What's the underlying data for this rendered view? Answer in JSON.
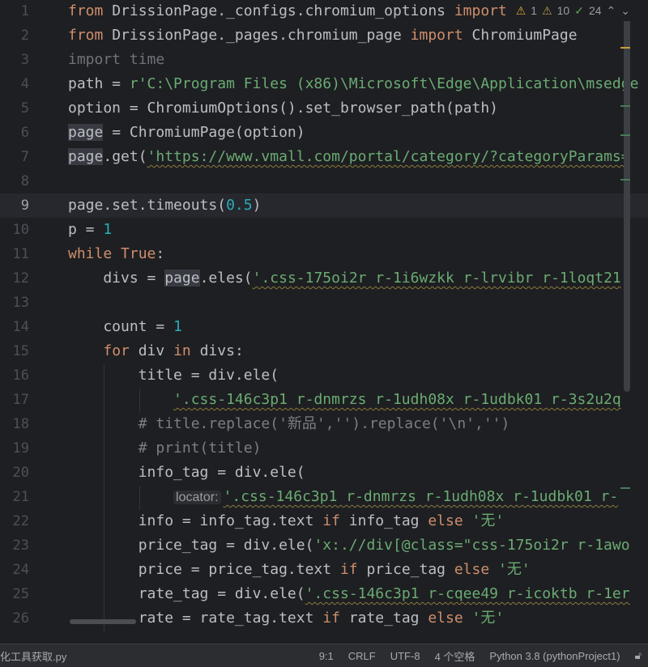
{
  "inspections": {
    "errors": "1",
    "warnings": "10",
    "ok": "24"
  },
  "lines": [
    [
      [
        "from ",
        "kw"
      ],
      [
        "DrissionPage._configs.chromium_options ",
        ""
      ],
      [
        "import",
        "kw"
      ]
    ],
    [
      [
        "from ",
        "kw"
      ],
      [
        "DrissionPage._pages.chromium_page ",
        ""
      ],
      [
        "import ",
        "kw"
      ],
      [
        "ChromiumPage",
        ""
      ]
    ],
    [
      [
        "import time",
        "dim"
      ]
    ],
    [
      [
        "path = ",
        ""
      ],
      [
        "r'C:\\Program Files (x86)\\Microsoft\\Edge\\Application\\msedge",
        "st"
      ]
    ],
    [
      [
        "option = ChromiumOptions().set_browser_path(path)",
        ""
      ]
    ],
    [
      [
        "page",
        "hl"
      ],
      [
        " = ChromiumPage(option)",
        ""
      ]
    ],
    [
      [
        "page",
        "hl"
      ],
      [
        ".get(",
        ""
      ],
      [
        "'https://www.vmall.com/portal/category/?categoryParams=",
        "st wavy"
      ]
    ],
    [],
    [
      [
        "page.set.timeouts(",
        ""
      ],
      [
        "0.5",
        "nu"
      ],
      [
        ")",
        ""
      ]
    ],
    [
      [
        "p = ",
        ""
      ],
      [
        "1",
        "nu"
      ]
    ],
    [
      [
        "while ",
        "kw"
      ],
      [
        "True",
        "kw"
      ],
      [
        ":",
        ""
      ]
    ],
    [
      [
        "    divs = ",
        ""
      ],
      [
        "page",
        "hl"
      ],
      [
        ".eles(",
        ""
      ],
      [
        "'.css-175oi2r r-1i6wzkk r-lrvibr r-1loqt21",
        "st wavy"
      ]
    ],
    [],
    [
      [
        "    count = ",
        ""
      ],
      [
        "1",
        "nu"
      ]
    ],
    [
      [
        "    ",
        ""
      ],
      [
        "for ",
        "kw"
      ],
      [
        "div ",
        ""
      ],
      [
        "in ",
        "kw"
      ],
      [
        "divs:",
        ""
      ]
    ],
    [
      [
        "        title = div.ele(",
        ""
      ]
    ],
    [
      [
        "            ",
        ""
      ],
      [
        "'.css-146c3p1 r-dnmrzs r-1udh08x r-1udbk01 r-3s2u2q",
        "st wavy"
      ]
    ],
    [
      [
        "        # title.replace('新品','').replace('\\n','')",
        "cm"
      ]
    ],
    [
      [
        "        # print(title)",
        "cm"
      ]
    ],
    [
      [
        "        info_tag = div.ele(",
        ""
      ]
    ],
    [
      [
        "            ",
        ""
      ],
      [
        "locator:",
        "hint"
      ],
      [
        "'.css-146c3p1 r-dnmrzs r-1udh08x r-1udbk01 r-",
        "st wavy"
      ]
    ],
    [
      [
        "        info = info_tag.text ",
        ""
      ],
      [
        "if ",
        "kw"
      ],
      [
        "info_tag ",
        ""
      ],
      [
        "else ",
        "kw"
      ],
      [
        "'无'",
        "st"
      ]
    ],
    [
      [
        "        price_tag = div.ele(",
        ""
      ],
      [
        "'x:.//div[@class=\"css-175oi2r r-1awo",
        "st"
      ]
    ],
    [
      [
        "        price = price_tag.text ",
        ""
      ],
      [
        "if ",
        "kw"
      ],
      [
        "price_tag ",
        ""
      ],
      [
        "else ",
        "kw"
      ],
      [
        "'无'",
        "st"
      ]
    ],
    [
      [
        "        rate_tag = div.ele(",
        ""
      ],
      [
        "'.css-146c3p1 r-cqee49 r-icoktb r-1er",
        "st wavy"
      ]
    ],
    [
      [
        "        rate = rate_tag.text ",
        ""
      ],
      [
        "if ",
        "kw"
      ],
      [
        "rate_tag ",
        ""
      ],
      [
        "else ",
        "kw"
      ],
      [
        "'无'",
        "st"
      ]
    ]
  ],
  "current_line": 9,
  "status": {
    "file": "化工具获取.py",
    "position": "9:1",
    "line_ending": "CRLF",
    "encoding": "UTF-8",
    "indent": "4 个空格",
    "interpreter": "Python 3.8 (pythonProject1)"
  }
}
